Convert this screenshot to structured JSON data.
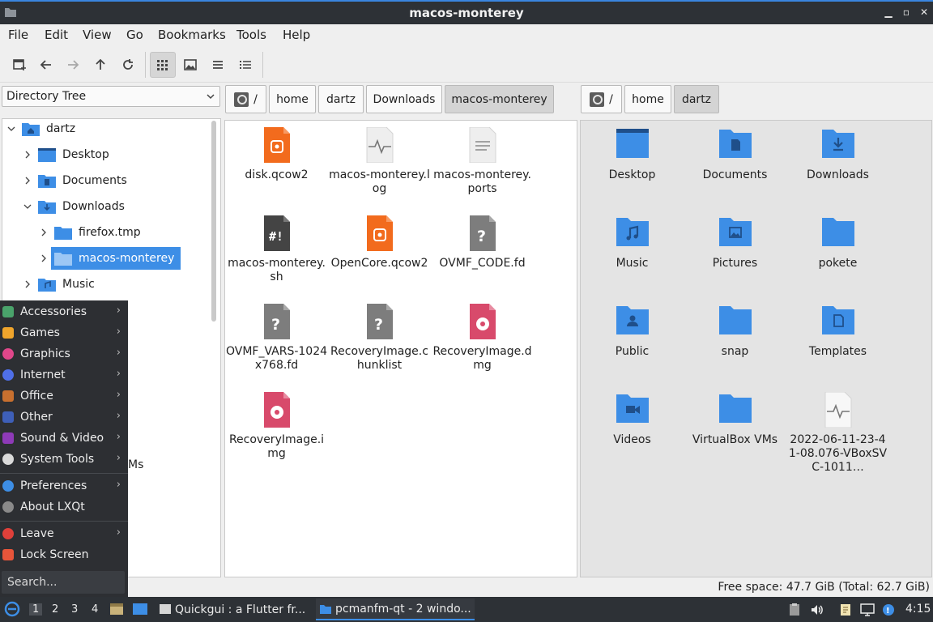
{
  "window": {
    "title": "macos-monterey"
  },
  "menubar": [
    "File",
    "Edit",
    "View",
    "Go",
    "Bookmarks",
    "Tools",
    "Help"
  ],
  "sidebar": {
    "mode": "Directory Tree",
    "tree": [
      {
        "label": "dartz",
        "icon": "home-folder-icon"
      },
      {
        "label": "Desktop",
        "icon": "desktop-folder-icon"
      },
      {
        "label": "Documents",
        "icon": "documents-folder-icon"
      },
      {
        "label": "Downloads",
        "icon": "downloads-folder-icon"
      },
      {
        "label": "firefox.tmp",
        "icon": "folder-icon"
      },
      {
        "label": "macos-monterey",
        "icon": "folder-icon",
        "selected": true
      },
      {
        "label": "Music",
        "icon": "music-folder-icon"
      }
    ],
    "partial_item_text": "Ms"
  },
  "left_path": [
    "home",
    "dartz",
    "Downloads",
    "macos-monterey"
  ],
  "right_path": [
    "home",
    "dartz"
  ],
  "left_files": [
    {
      "name": "disk.qcow2",
      "icon": "disk-image-icon"
    },
    {
      "name": "macos-monterey.log",
      "icon": "log-file-icon"
    },
    {
      "name": "macos-monterey.ports",
      "icon": "text-file-icon"
    },
    {
      "name": "macos-monterey.sh",
      "icon": "shell-script-icon"
    },
    {
      "name": "OpenCore.qcow2",
      "icon": "disk-image-icon"
    },
    {
      "name": "OVMF_CODE.fd",
      "icon": "unknown-file-icon"
    },
    {
      "name": "OVMF_VARS-1024x768.fd",
      "icon": "unknown-file-icon"
    },
    {
      "name": "RecoveryImage.chunklist",
      "icon": "unknown-file-icon"
    },
    {
      "name": "RecoveryImage.dmg",
      "icon": "optical-image-icon"
    },
    {
      "name": "RecoveryImage.img",
      "icon": "optical-image-icon"
    }
  ],
  "right_files": [
    {
      "name": "Desktop",
      "icon": "desktop-folder-icon"
    },
    {
      "name": "Documents",
      "icon": "documents-folder-icon"
    },
    {
      "name": "Downloads",
      "icon": "downloads-folder-icon"
    },
    {
      "name": "Music",
      "icon": "music-folder-icon"
    },
    {
      "name": "Pictures",
      "icon": "pictures-folder-icon"
    },
    {
      "name": "pokete",
      "icon": "folder-icon"
    },
    {
      "name": "Public",
      "icon": "public-folder-icon"
    },
    {
      "name": "snap",
      "icon": "folder-icon"
    },
    {
      "name": "Templates",
      "icon": "templates-folder-icon"
    },
    {
      "name": "Videos",
      "icon": "videos-folder-icon"
    },
    {
      "name": "VirtualBox VMs",
      "icon": "folder-icon"
    },
    {
      "name": "2022-06-11-23-41-08.076-VBoxSVC-1011…",
      "icon": "log-file-icon"
    }
  ],
  "status": {
    "free_space": "Free space: 47.7 GiB (Total: 62.7 GiB)"
  },
  "app_menu": {
    "items": [
      {
        "label": "Accessories",
        "icon": "accessories-icon",
        "submenu": true
      },
      {
        "label": "Games",
        "icon": "games-icon",
        "submenu": true
      },
      {
        "label": "Graphics",
        "icon": "graphics-icon",
        "submenu": true
      },
      {
        "label": "Internet",
        "icon": "internet-icon",
        "submenu": true
      },
      {
        "label": "Office",
        "icon": "office-icon",
        "submenu": true
      },
      {
        "label": "Other",
        "icon": "other-icon",
        "submenu": true
      },
      {
        "label": "Sound & Video",
        "icon": "sound-video-icon",
        "submenu": true
      },
      {
        "label": "System Tools",
        "icon": "system-tools-icon",
        "submenu": true
      },
      {
        "label": "Preferences",
        "icon": "preferences-icon",
        "submenu": true
      },
      {
        "label": "About LXQt",
        "icon": "info-icon",
        "submenu": false
      },
      {
        "label": "Leave",
        "icon": "power-icon",
        "submenu": true
      },
      {
        "label": "Lock Screen",
        "icon": "lock-icon",
        "submenu": false
      }
    ],
    "search_placeholder": "Search..."
  },
  "taskbar": {
    "desktops": [
      "1",
      "2",
      "3",
      "4"
    ],
    "tasks": [
      {
        "label": "Quickgui : a Flutter fr...",
        "active": false
      },
      {
        "label": "pcmanfm-qt - 2 windo...",
        "active": true
      }
    ],
    "clock": "4:15"
  },
  "colors": {
    "accent": "#3d8ee6",
    "folder": "#3d8ee6",
    "orange": "#f26b1d",
    "pink": "#d84a6b"
  }
}
